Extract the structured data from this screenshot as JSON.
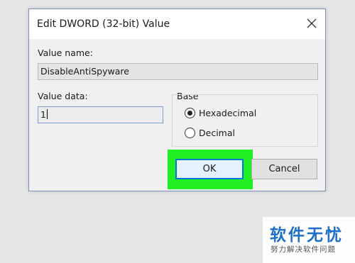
{
  "dialog": {
    "title": "Edit DWORD (32-bit) Value",
    "value_name_label": "Value name:",
    "value_name": "DisableAntiSpyware",
    "value_data_label": "Value data:",
    "value_data": "1",
    "base_label": "Base",
    "base_options": [
      {
        "label": "Hexadecimal",
        "checked": true
      },
      {
        "label": "Decimal",
        "checked": false
      }
    ],
    "ok_label": "OK",
    "cancel_label": "Cancel",
    "close_icon": "close-icon"
  },
  "highlight_color": "#22ef22",
  "watermark": {
    "main": "软件无忧",
    "sub": "努力解决软件问题",
    "color": "#1e6fc8"
  }
}
